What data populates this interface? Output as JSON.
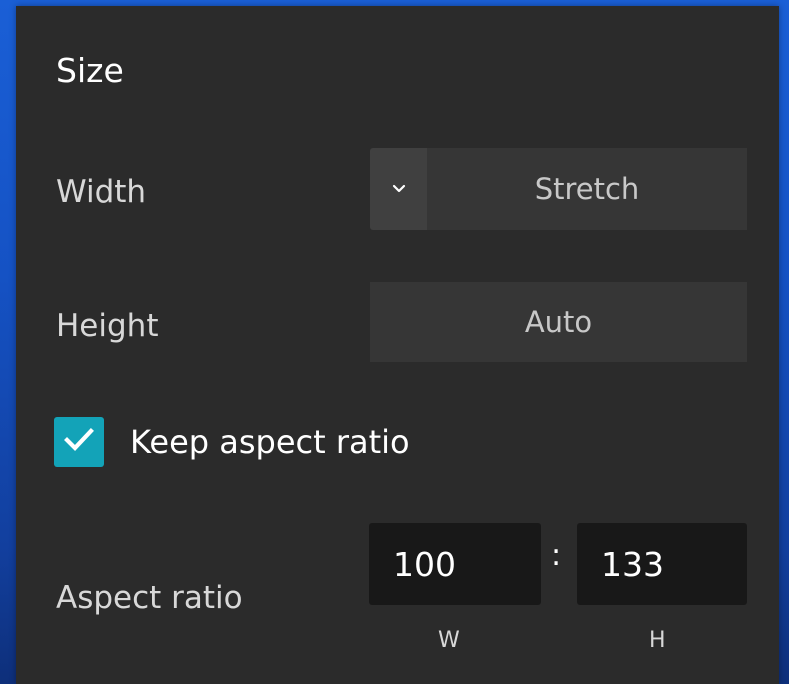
{
  "panel": {
    "title": "Size",
    "width": {
      "label": "Width",
      "value": "Stretch",
      "dropdown_icon": "chevron-down-icon"
    },
    "height": {
      "label": "Height",
      "value": "Auto"
    },
    "keep_aspect_ratio": {
      "label": "Keep aspect ratio",
      "checked": true,
      "color": "#13a3b8"
    },
    "aspect_ratio": {
      "label": "Aspect ratio",
      "w_value": "100",
      "h_value": "133",
      "separator": ":",
      "w_caption": "W",
      "h_caption": "H"
    }
  }
}
